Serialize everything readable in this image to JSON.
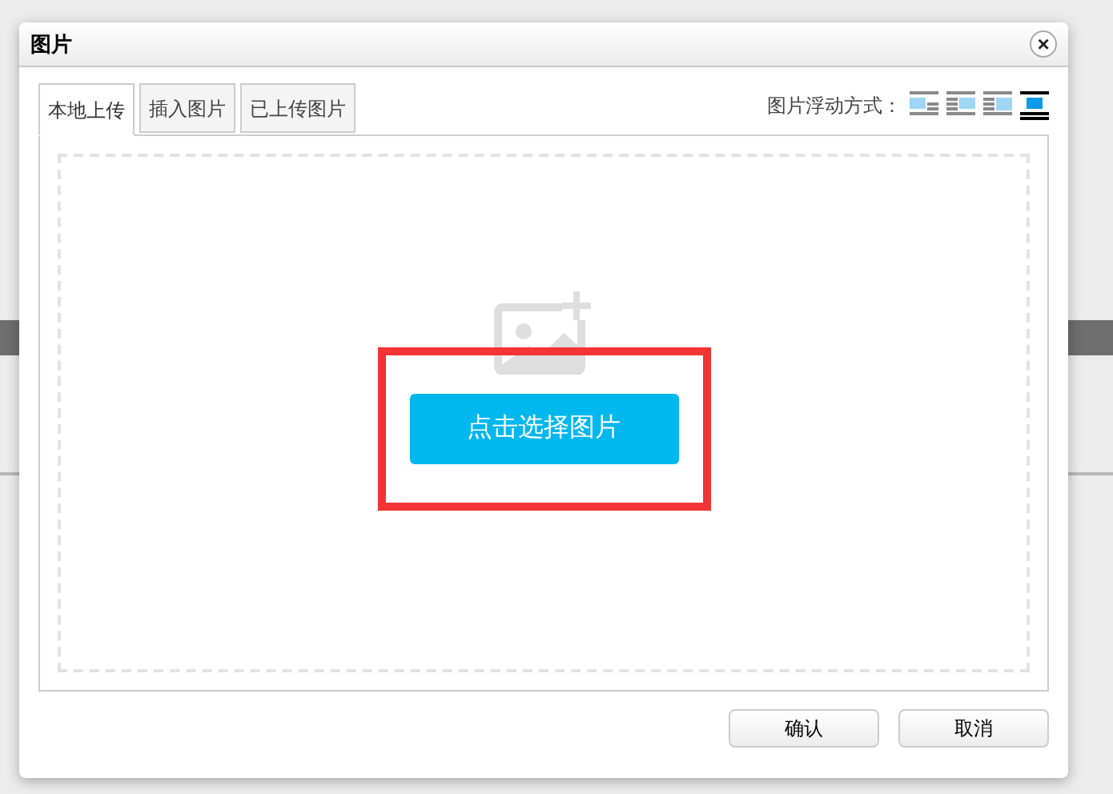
{
  "dialog": {
    "title": "图片",
    "close_label": "×"
  },
  "tabs": [
    {
      "label": "本地上传",
      "selected": true
    },
    {
      "label": "插入图片",
      "selected": false
    },
    {
      "label": "已上传图片",
      "selected": false
    }
  ],
  "float_setting": {
    "label": "图片浮动方式：",
    "options": [
      {
        "kind": "left",
        "selected": false
      },
      {
        "kind": "right",
        "selected": false
      },
      {
        "kind": "inline",
        "selected": false
      },
      {
        "kind": "center",
        "selected": true
      }
    ]
  },
  "upload": {
    "button": "点击选择图片",
    "highlighted": true
  },
  "buttons": [
    "确认",
    "取消"
  ]
}
